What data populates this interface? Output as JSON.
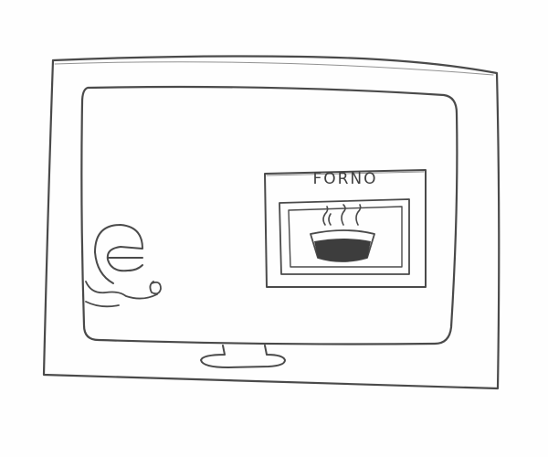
{
  "oven": {
    "label": "FORNO"
  }
}
